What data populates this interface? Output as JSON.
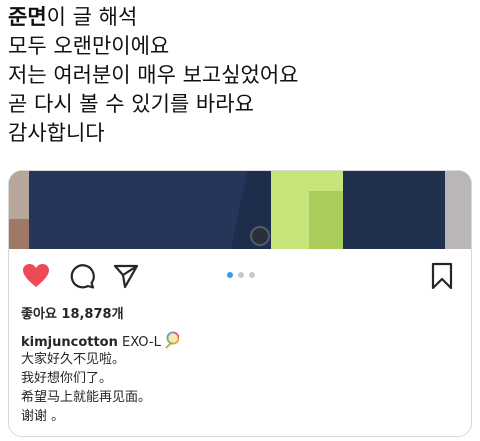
{
  "tweet": {
    "mention": "준면",
    "line1_rest": "이 글 해석",
    "line2": "모두 오랜만이에요",
    "line3": "저는 여러분이 매우 보고싶었어요",
    "line4": "곧 다시 볼 수 있기를 바라요",
    "line5": "감사합니다"
  },
  "post": {
    "likes_text": "좋아요 18,878개",
    "username": "kimjuncotton",
    "caption_first": "EXO-L",
    "caption_emoji": "lollipop-icon",
    "caption_lines": [
      "大家好久不见啦。",
      "我好想你们了。",
      "希望马上就能再见面。",
      "谢谢 。"
    ],
    "carousel": {
      "count": 3,
      "active_index": 0
    }
  },
  "colors": {
    "like_red": "#ed4956",
    "carousel_active": "#3897f0",
    "carousel_inactive": "#c8c8c8",
    "card_border": "#d9d9d9"
  }
}
